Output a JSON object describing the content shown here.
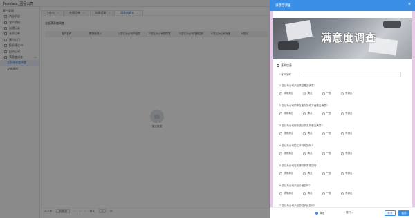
{
  "app": {
    "title": "Teamface_团品公司"
  },
  "sidebar": {
    "header": "客户管理",
    "items": [
      {
        "label": "商业机会"
      },
      {
        "label": "客户资料"
      },
      {
        "label": "沟通记录"
      },
      {
        "label": "合同订单"
      },
      {
        "label": "预约上门"
      },
      {
        "label": "投诉建议书"
      },
      {
        "label": "回访记录"
      },
      {
        "label": "满意度调查",
        "more": "•••"
      },
      {
        "label": "全部满意度调查"
      },
      {
        "label": "发放通知"
      }
    ]
  },
  "tabs": [
    {
      "label": "工作台"
    },
    {
      "label": "合同订单"
    },
    {
      "label": "沟通记录"
    },
    {
      "label": "满意度调查"
    }
  ],
  "main": {
    "title": "全部满意度调查",
    "columns": [
      "客户名称",
      "需查负责人",
      "1.您认为公司产品质",
      "2.您认为公司同学签",
      "3.您认为公司付款招标",
      "4.您认为公司对接",
      "5.您认"
    ],
    "empty_text": "暂无数据"
  },
  "pager": {
    "total": "共 0 条",
    "page_size": "20条/页",
    "prev": "‹",
    "page": "1",
    "next": "›",
    "goto_label": "前往",
    "goto_value": "1",
    "unit": "页"
  },
  "drawer": {
    "title": "满意度调查",
    "close": "×",
    "banner_title": "满意度调查",
    "section": "基本信息",
    "customer_label": "客户名称",
    "questions": [
      "1.您认为公司产品质量是否满意?",
      "2.您认为公司同事在团队协作方面是否满意?",
      "3.您认为公司服务团队的支持是否满意?",
      "4.您认为公司的工作时效如何?",
      "5.您认为公司在关键时刻表现如何?",
      "6.您认为公司产品价格如何?",
      "7.您认为公司产品的性价比如何?"
    ],
    "options": [
      "非常满意",
      "满意",
      "一般",
      "不满意"
    ],
    "footer": {
      "status": "清理",
      "expand": "展开 ⌄",
      "cancel": "取消",
      "ok": "保存"
    }
  }
}
